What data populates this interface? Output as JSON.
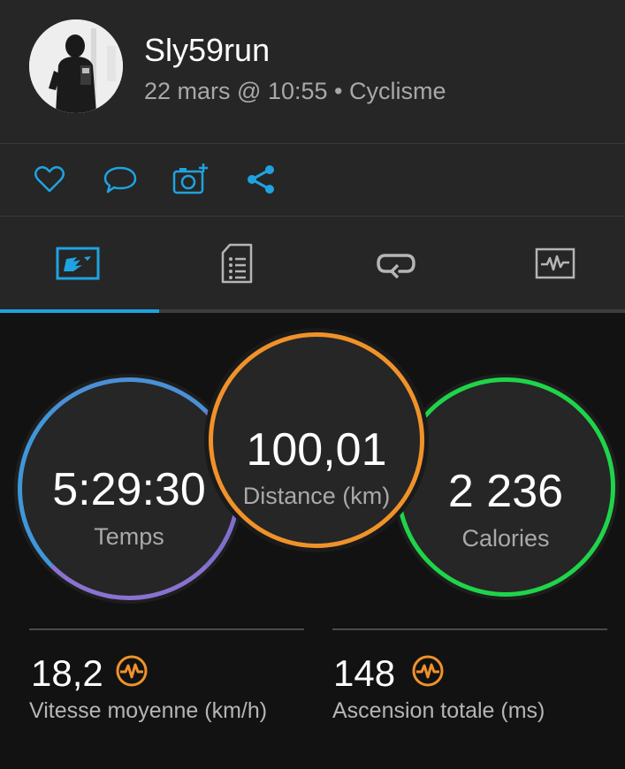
{
  "activity": {
    "username": "Sly59run",
    "meta": "22 mars @ 10:55 • Cyclisme"
  },
  "actions": [
    {
      "icon": "heart-icon"
    },
    {
      "icon": "comment-icon"
    },
    {
      "icon": "add-photo-icon"
    },
    {
      "icon": "share-icon"
    }
  ],
  "tabs": [
    {
      "icon": "overview-map-icon",
      "active": true
    },
    {
      "icon": "details-list-icon",
      "active": false
    },
    {
      "icon": "laps-icon",
      "active": false
    },
    {
      "icon": "charts-icon",
      "active": false
    }
  ],
  "summary": {
    "time": {
      "value": "5:29:30",
      "label": "Temps"
    },
    "distance": {
      "value": "100,01",
      "label": "Distance (km)"
    },
    "calories": {
      "value": "2 236",
      "label": "Calories"
    }
  },
  "stats": [
    {
      "value": "18,2",
      "label": "Vitesse moyenne (km/h)",
      "icon": "performance-icon"
    },
    {
      "value": "148",
      "label": "Ascension totale (ms)",
      "icon": "performance-icon"
    }
  ],
  "colors": {
    "accent": "#1fa3e0",
    "distance_ring": "#f0922a",
    "calories_ring": "#1fd44a",
    "time_ring": "#4a90d6",
    "stat_icon": "#f0922a"
  }
}
